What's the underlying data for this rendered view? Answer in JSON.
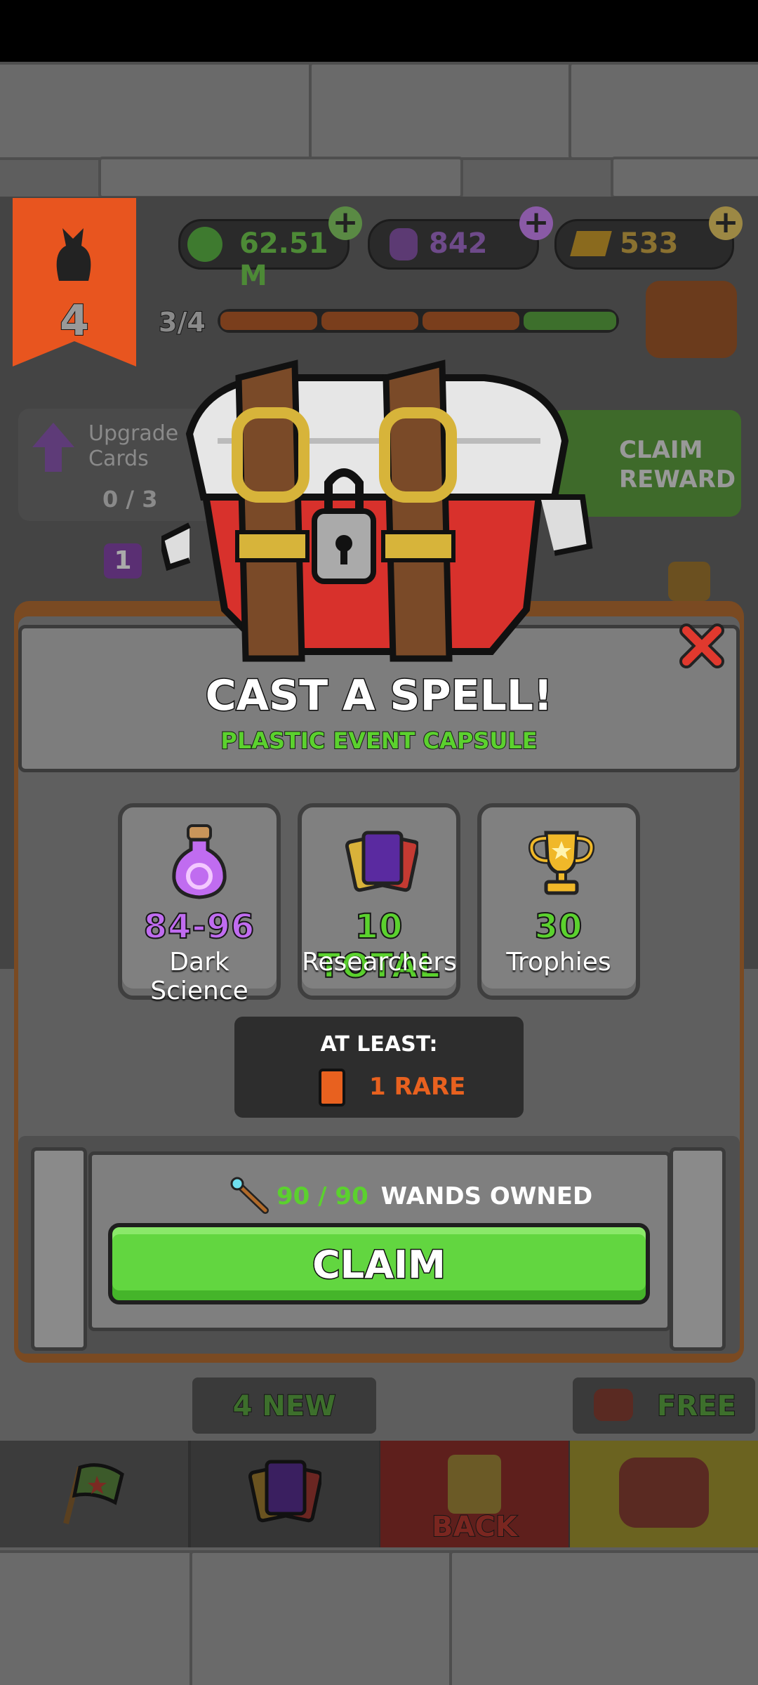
{
  "resources": {
    "cash": "62.51 M",
    "dark_science": "842",
    "gold": "533"
  },
  "player": {
    "level": "4",
    "progress": "3/4"
  },
  "quests": {
    "upgrade_title": "Upgrade Cards",
    "upgrade_progress": "0 / 3",
    "claim_reward": "CLAIM REWARD",
    "badge_count": "1"
  },
  "dialog": {
    "title": "CAST A SPELL!",
    "subtitle": "PLASTIC EVENT CAPSULE",
    "close_icon": "close-icon",
    "rewards": [
      {
        "value": "84-96",
        "label": "Dark Science",
        "icon": "potion-icon",
        "color": "#c06cf0"
      },
      {
        "value": "10 TOTAL",
        "label": "Researchers",
        "icon": "cards-icon",
        "color": "#5bd12e"
      },
      {
        "value": "30",
        "label": "Trophies",
        "icon": "trophy-icon",
        "color": "#5bd12e"
      }
    ],
    "at_least_label": "AT LEAST:",
    "at_least_value": "1 RARE",
    "wands_current": "90",
    "wands_sep": " / ",
    "wands_max": "90",
    "wands_label": "WANDS OWNED",
    "claim_button": "CLAIM"
  },
  "nav": {
    "new_badge": "4 NEW",
    "free_badge": "FREE",
    "back_label": "BACK"
  },
  "colors": {
    "accent_green": "#5bd12e",
    "purple": "#c06cf0",
    "rare_orange": "#e8611f",
    "claim_button": "#62d640"
  }
}
